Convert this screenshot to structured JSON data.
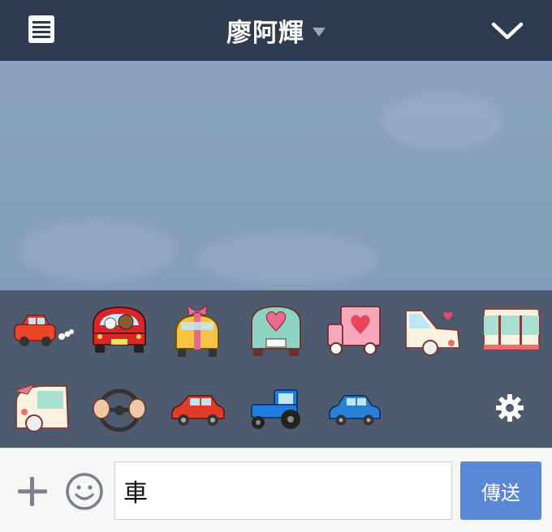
{
  "header": {
    "title": "廖阿輝",
    "menu_icon": "list-icon",
    "dropdown_icon": "caret-down-icon",
    "collapse_icon": "chevron-down-icon",
    "background": "#2e3a4f"
  },
  "chat": {
    "background": "#869fbd"
  },
  "sticker_panel": {
    "background": "#4e5a6d",
    "stickers": [
      {
        "name": "red-car-puff-sticker"
      },
      {
        "name": "brown-cony-driving-car-sticker"
      },
      {
        "name": "yellow-car-with-ribbon-sticker"
      },
      {
        "name": "teal-car-heart-sticker"
      },
      {
        "name": "pink-truck-heart-sticker"
      },
      {
        "name": "cream-car-heart-sticker"
      },
      {
        "name": "bus-side-sticker"
      },
      {
        "name": "car-with-flag-sticker"
      },
      {
        "name": "steering-wheel-hands-sticker"
      },
      {
        "name": "red-hatchback-sticker"
      },
      {
        "name": "blue-tractor-sticker"
      },
      {
        "name": "blue-car-sticker"
      }
    ],
    "settings_icon": "gear-icon"
  },
  "input_bar": {
    "plus_icon": "plus-icon",
    "emoji_icon": "smiley-icon",
    "message_value": "車",
    "send_label": "傳送",
    "send_color": "#5b87d8"
  }
}
